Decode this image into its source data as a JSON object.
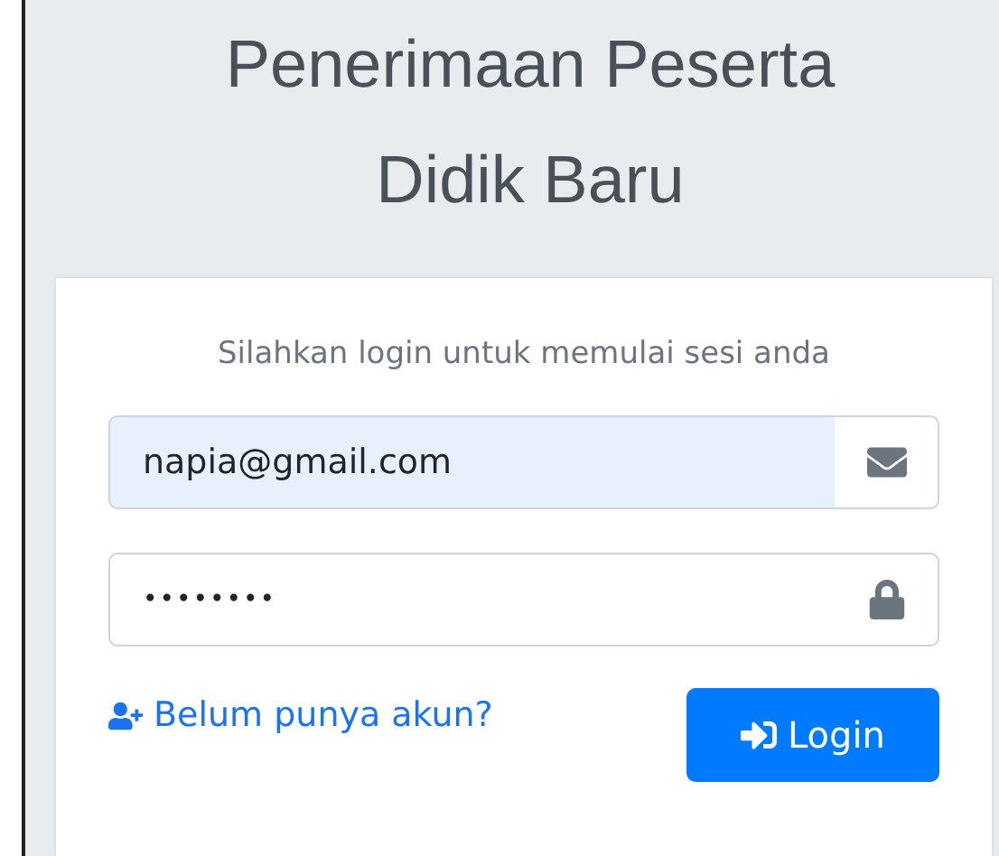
{
  "title": "Penerimaan Peserta Didik Baru",
  "card": {
    "message": "Silahkan login untuk memulai sesi anda",
    "email": {
      "value": "napia@gmail.com",
      "autofilled": true
    },
    "password": {
      "value": "••••••••"
    },
    "register_link": "Belum punya akun?",
    "login_button": "Login"
  }
}
